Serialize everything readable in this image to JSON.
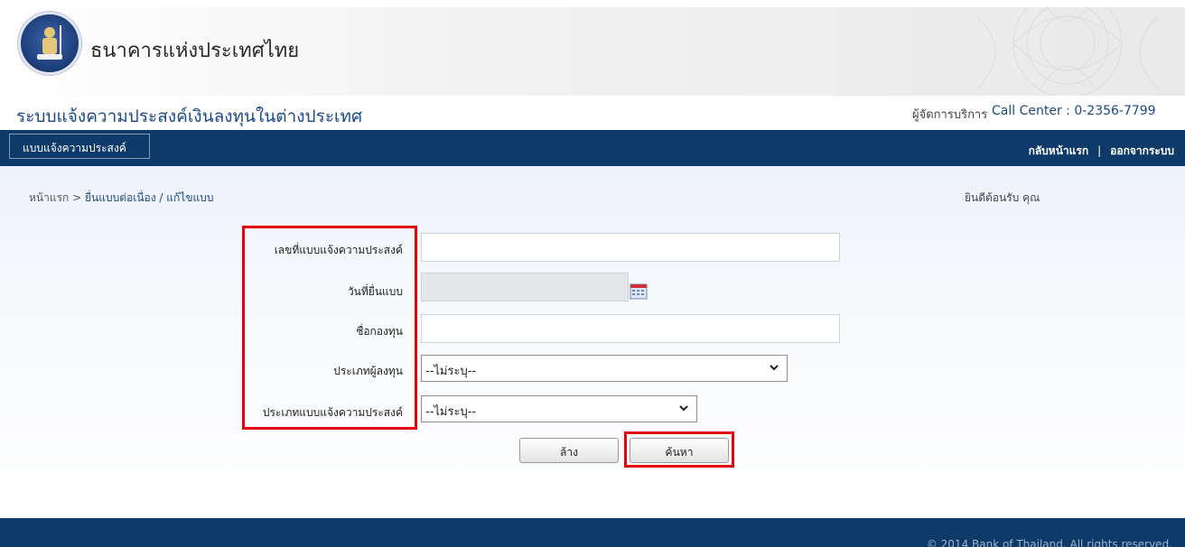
{
  "header": {
    "bank_name": "ธนาคารแห่งประเทศไทย",
    "system_title": "ระบบแจ้งความประสงค์เงินลงทุนในต่างประเทศ",
    "service_manager": "ผู้จัดการบริการ",
    "call_center": "Call Center : 0-2356-7799"
  },
  "nav": {
    "tab_label": "แบบแจ้งความประสงค์",
    "home_link": "กลับหน้าแรก",
    "separator": "|",
    "logout_link": "ออกจากระบบ"
  },
  "breadcrumb": {
    "home": "หน้าแรก",
    "separator": ">",
    "current": "ยื่นแบบต่อเนื่อง / แก้ไขแบบ"
  },
  "welcome": "ยินดีต้อนรับ คุณ",
  "form": {
    "form_no_label": "เลขที่แบบแจ้งความประสงค์",
    "form_no_value": "",
    "submit_date_label": "วันที่ยื่นแบบ",
    "submit_date_value": "",
    "fund_name_label": "ชื่อกองทุน",
    "fund_name_value": "",
    "investor_type_label": "ประเภทผู้ลงทุน",
    "investor_type_value": "--ไม่ระบุ--",
    "form_type_label": "ประเภทแบบแจ้งความประสงค์",
    "form_type_value": "--ไม่ระบุ--"
  },
  "buttons": {
    "clear": "ล้าง",
    "search": "ค้นหา"
  },
  "footer": {
    "copyright": "© 2014 Bank of Thailand. All rights reserved."
  },
  "colors": {
    "navy": "#0e3a6a",
    "title_blue": "#1b4a86",
    "highlight_red": "#e3000f"
  }
}
